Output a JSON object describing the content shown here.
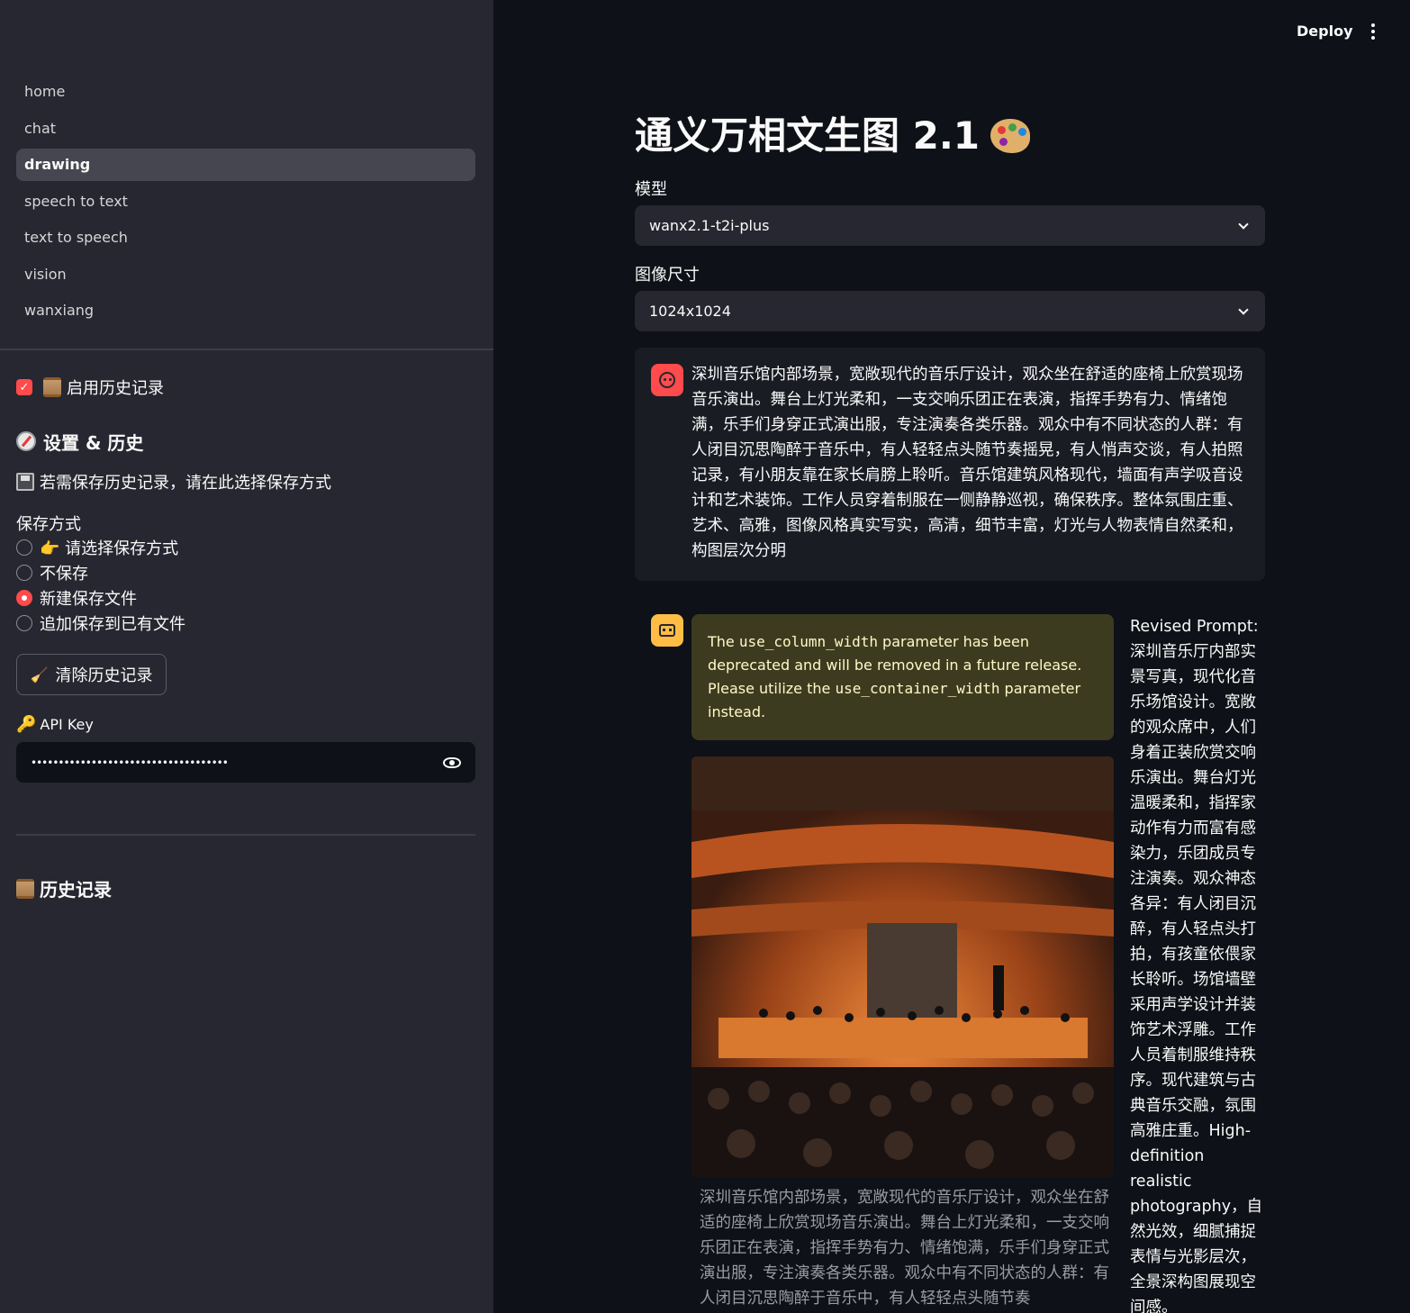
{
  "sidebar": {
    "nav": [
      "home",
      "chat",
      "drawing",
      "speech to text",
      "text to speech",
      "vision",
      "wanxiang"
    ],
    "active_nav": "drawing",
    "history_checkbox_label": "启用历史记录",
    "settings_title": "设置 & 历史",
    "save_hint": "若需保存历史记录，请在此选择保存方式",
    "save_mode_label": "保存方式",
    "save_options": [
      "👉 请选择保存方式",
      "不保存",
      "新建保存文件",
      "追加保存到已有文件"
    ],
    "save_selected": "新建保存文件",
    "clear_button": "清除历史记录",
    "api_key_label": "API Key",
    "api_key_value": "••••••••••••••••••••••••••••••••••••",
    "history_title": "历史记录"
  },
  "header": {
    "deploy": "Deploy"
  },
  "main": {
    "title": "通义万相文生图 2.1",
    "model_label": "模型",
    "model_value": "wanx2.1-t2i-plus",
    "size_label": "图像尺寸",
    "size_value": "1024x1024",
    "user_prompt": "深圳音乐馆内部场景，宽敞现代的音乐厅设计，观众坐在舒适的座椅上欣赏现场音乐演出。舞台上灯光柔和，一支交响乐团正在表演，指挥手势有力、情绪饱满，乐手们身穿正式演出服，专注演奏各类乐器。观众中有不同状态的人群：有人闭目沉思陶醉于音乐中，有人轻轻点头随节奏摇晃，有人悄声交谈，有人拍照记录，有小朋友靠在家长肩膀上聆听。音乐馆建筑风格现代，墙面有声学吸音设计和艺术装饰。工作人员穿着制服在一侧静静巡视，确保秩序。整体氛围庄重、艺术、高雅，图像风格真实写实，高清，细节丰富，灯光与人物表情自然柔和，构图层次分明",
    "warning_pre": "The ",
    "warning_code1": "use_column_width",
    "warning_mid": " parameter has been deprecated and will be removed in a future release. Please utilize the ",
    "warning_code2": "use_container_width",
    "warning_post": " parameter instead.",
    "caption": "深圳音乐馆内部场景，宽敞现代的音乐厅设计，观众坐在舒适的座椅上欣赏现场音乐演出。舞台上灯光柔和，一支交响乐团正在表演，指挥手势有力、情绪饱满，乐手们身穿正式演出服，专注演奏各类乐器。观众中有不同状态的人群：有人闭目沉思陶醉于音乐中，有人轻轻点头随节奏",
    "revised_prompt": "Revised Prompt: 深圳音乐厅内部实景写真，现代化音乐场馆设计。宽敞的观众席中，人们身着正装欣赏交响乐演出。舞台灯光温暖柔和，指挥家动作有力而富有感染力，乐团成员专注演奏。观众神态各异：有人闭目沉醉，有人轻点头打拍，有孩童依偎家长聆听。场馆墙壁采用声学设计并装饰艺术浮雕。工作人员着制服维持秩序。现代建筑与古典音乐交融，氛围高雅庄重。High-definition realistic photography，自然光效，细腻捕捉表情与光影层次，全景深构图展现空间感。"
  },
  "colors": {
    "primary": "#ff4b4b",
    "background": "#0e1117",
    "sidebar": "#262730",
    "bot_avatar": "#ffbd45"
  }
}
